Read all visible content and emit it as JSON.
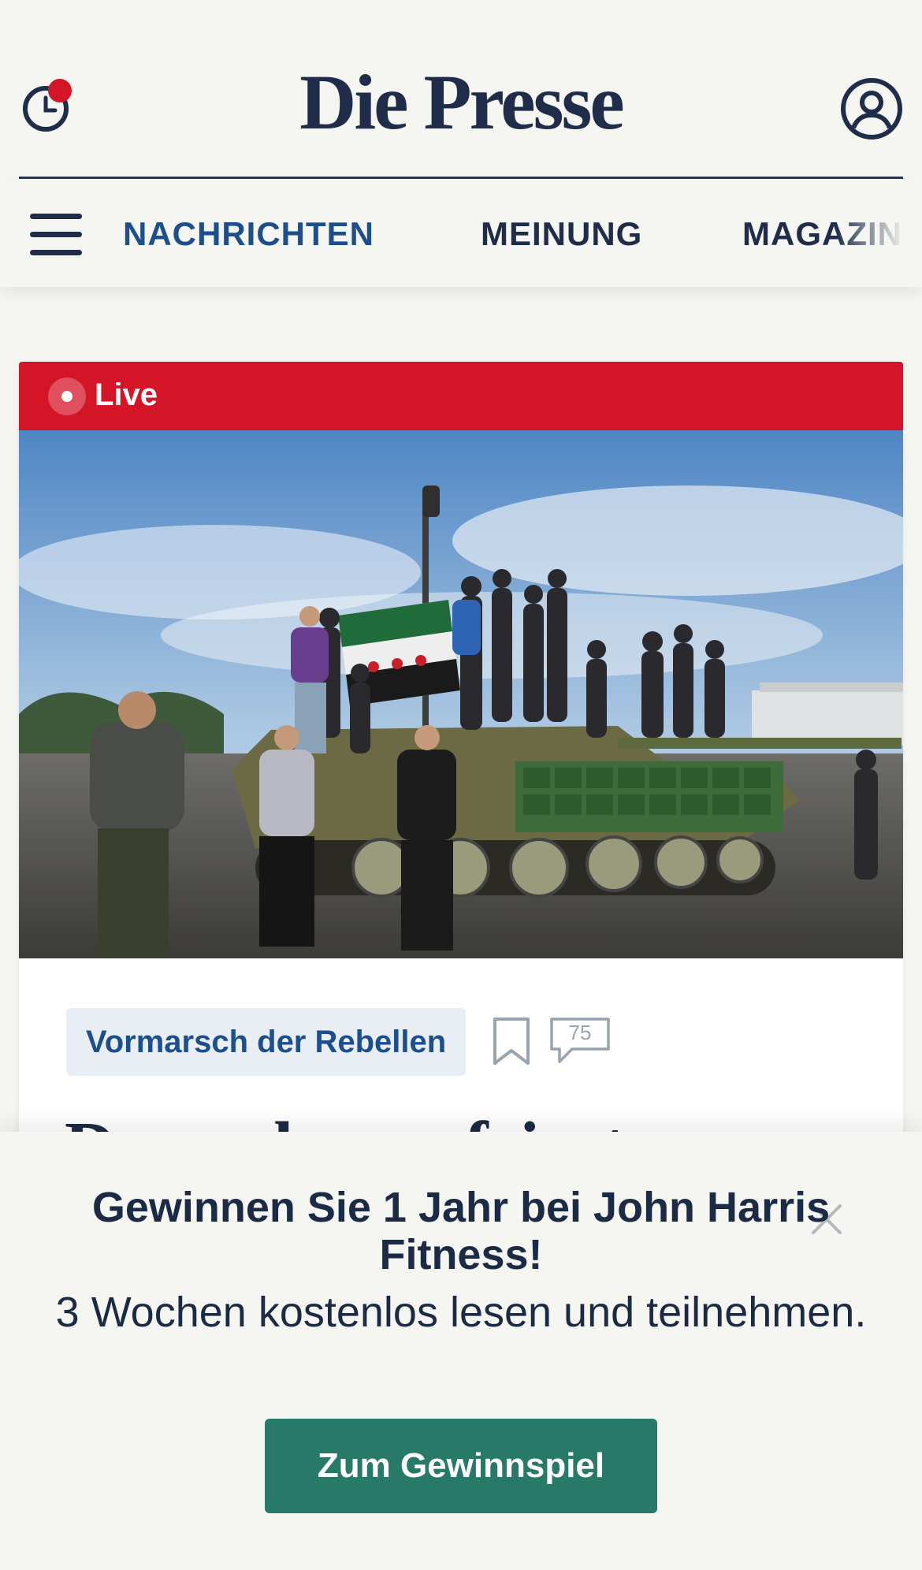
{
  "header": {
    "logo": "Die Presse",
    "notification_dot_color": "#d41528"
  },
  "nav": {
    "items": [
      {
        "label": "NACHRICHTEN",
        "active": true
      },
      {
        "label": "MEINUNG",
        "active": false
      },
      {
        "label": "MAGAZIN",
        "active": false
      }
    ]
  },
  "article": {
    "live_label": "Live",
    "image_icon": "news-photo-tank-crowd",
    "tag": "Vormarsch der Rebellen",
    "comment_count": "75",
    "headline_partial": "Damaskus gefeiert"
  },
  "promo": {
    "title": "Gewinnen Sie 1 Jahr bei John Harris Fitness!",
    "subtitle": "3 Wochen kostenlos lesen und teilnehmen.",
    "cta_label": "Zum Gewinnspiel"
  },
  "colors": {
    "brand_navy": "#1f2c4a",
    "live_red": "#d41528",
    "cta_green": "#277a67",
    "nav_active": "#1d4f8c"
  }
}
